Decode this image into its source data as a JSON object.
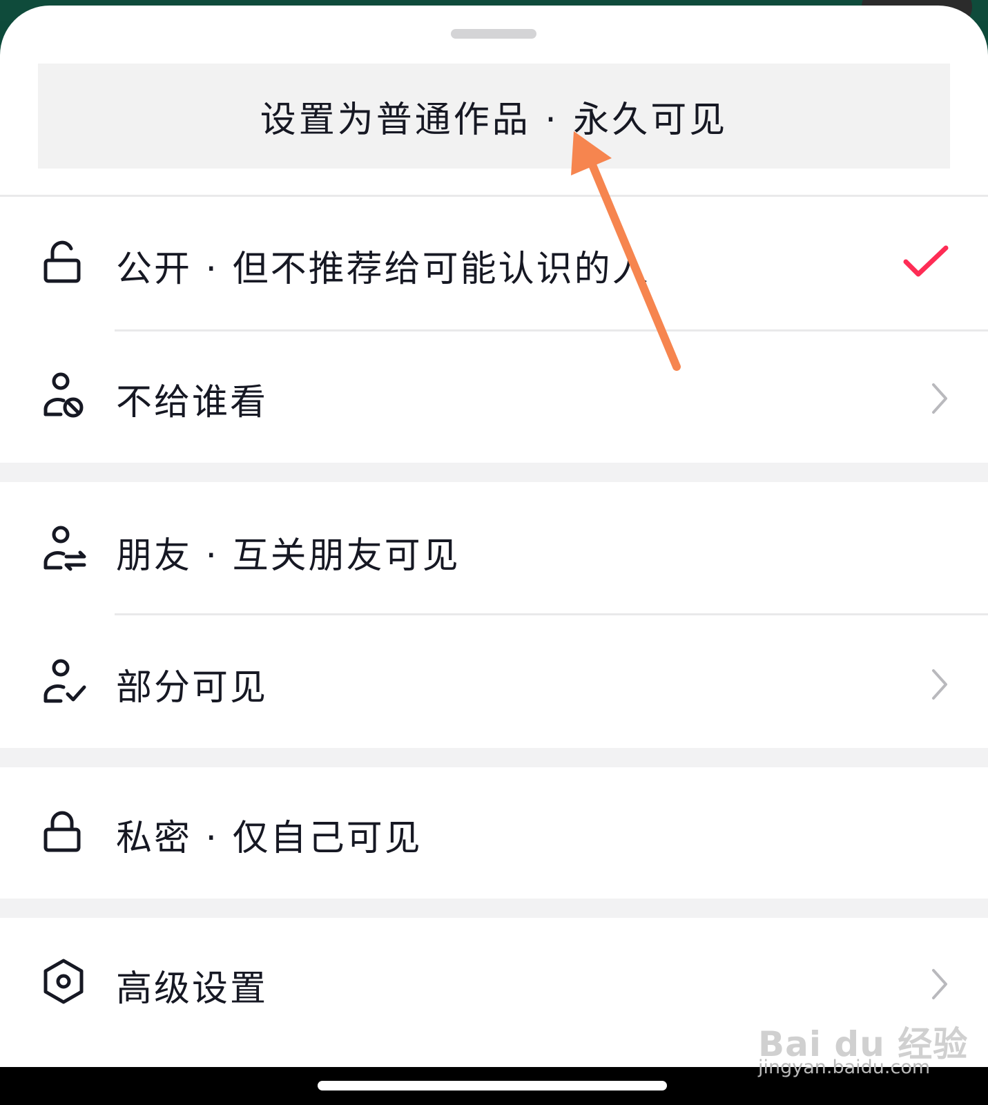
{
  "banner": {
    "text": "设置为普通作品 · 永久可见"
  },
  "options": [
    {
      "label": "公开 · 但不推荐给可能认识的人",
      "icon": "unlock-icon",
      "selected": true
    },
    {
      "label": "不给谁看",
      "icon": "user-block-icon",
      "has_chevron": true
    },
    {
      "label": "朋友 · 互关朋友可见",
      "icon": "user-swap-icon"
    },
    {
      "label": "部分可见",
      "icon": "user-check-icon",
      "has_chevron": true
    },
    {
      "label": "私密 · 仅自己可见",
      "icon": "lock-icon"
    },
    {
      "label": "高级设置",
      "icon": "hexagon-settings-icon",
      "has_chevron": true
    }
  ],
  "colors": {
    "check": "#fe2c55",
    "arrow": "#f6854f",
    "text": "#161823"
  },
  "watermark": {
    "logo": "Bai du 经验",
    "url": "jingyan.baidu.com"
  }
}
